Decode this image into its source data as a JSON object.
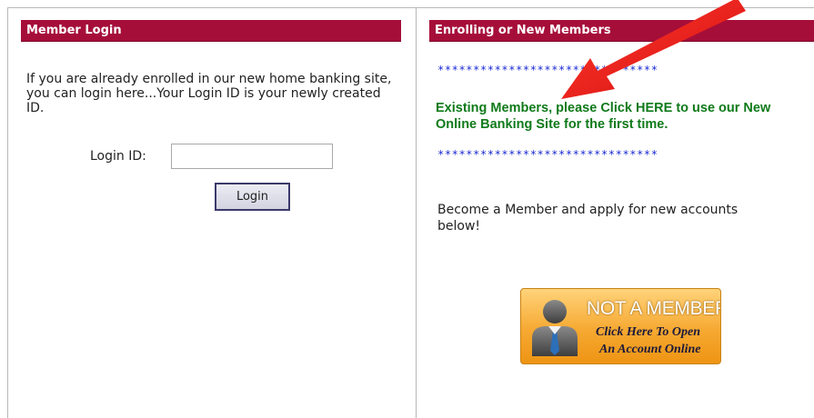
{
  "left_panel": {
    "header": "Member Login",
    "intro": "If you are already enrolled in our new home banking site, you can login here...Your Login ID is your newly created ID.",
    "login_label": "Login ID:",
    "login_value": "",
    "login_placeholder": "",
    "login_button": "Login"
  },
  "right_panel": {
    "header": "Enrolling or New Members",
    "stars_top": "*******************************",
    "existing_link": "Existing Members, please Click HERE to use our New Online Banking Site for the first time.",
    "stars_bottom": "*******************************",
    "become_text": "Become a Member and apply for new accounts below!",
    "not_member_button": {
      "title": "NOT A MEMBER?",
      "line1": "Click Here To Open",
      "line2": "An Account Online"
    }
  },
  "annotation": {
    "arrow_color": "#e8131a"
  },
  "colors": {
    "header_bg": "#a60e3a",
    "link_green": "#0f7a1a",
    "stars_blue": "#1a2ad4",
    "button_orange": "#f6a932"
  },
  "icons": {
    "member_icon": "person-silhouette-icon",
    "arrow": "pointer-arrow-icon"
  }
}
